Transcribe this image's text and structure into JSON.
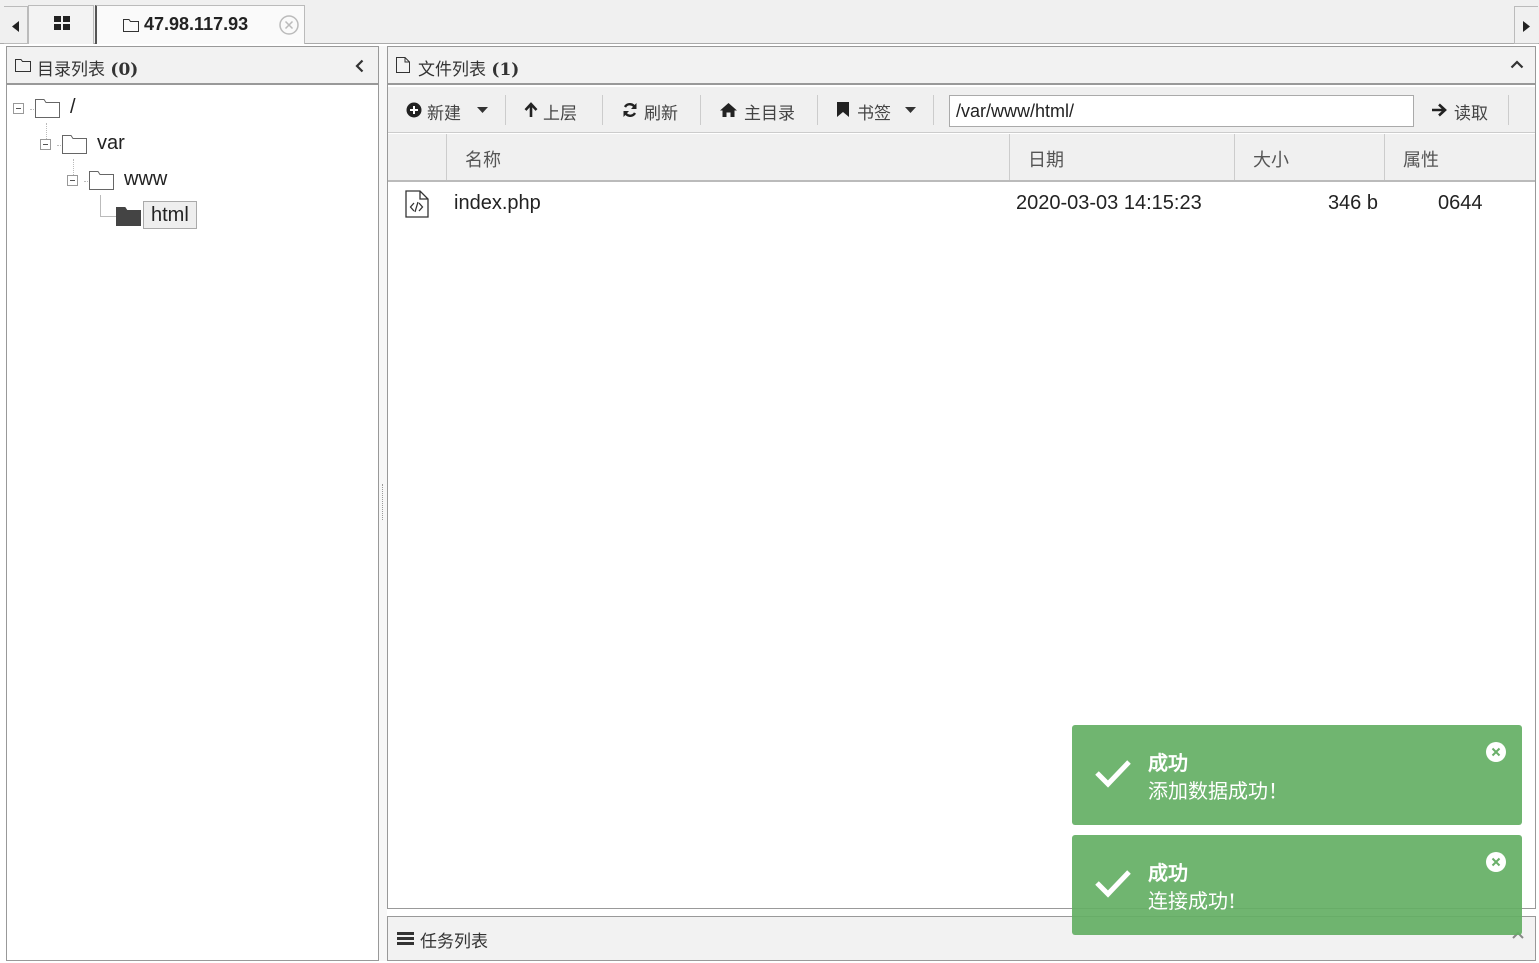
{
  "tabs": {
    "home_icon": "grid-icon",
    "active": {
      "title": "47.98.117.93",
      "icon": "folder-icon",
      "close_icon": "close-circle-icon"
    }
  },
  "dir_panel": {
    "title": "目录列表",
    "count": "(0)",
    "tree": [
      {
        "label": "/",
        "expanded": true
      },
      {
        "label": "var",
        "expanded": true
      },
      {
        "label": "www",
        "expanded": true
      },
      {
        "label": "html",
        "selected": true
      }
    ]
  },
  "file_panel": {
    "title": "文件列表",
    "count": "(1)",
    "toolbar": {
      "new_label": "新建",
      "up_label": "上层",
      "refresh_label": "刷新",
      "home_label": "主目录",
      "bookmark_label": "书签",
      "read_label": "读取",
      "path_value": "/var/www/html/"
    },
    "columns": [
      "名称",
      "日期",
      "大小",
      "属性"
    ],
    "rows": [
      {
        "name": "index.php",
        "date": "2020-03-03 14:15:23",
        "size": "346 b",
        "attr": "0644"
      }
    ]
  },
  "task_panel": {
    "title": "任务列表"
  },
  "toasts": [
    {
      "title": "成功",
      "message": "添加数据成功！"
    },
    {
      "title": "成功",
      "message": "连接成功!"
    }
  ],
  "colors": {
    "toast_bg": "#6aaf6a",
    "panel_header": "#f2f2f2",
    "border": "#999999"
  }
}
